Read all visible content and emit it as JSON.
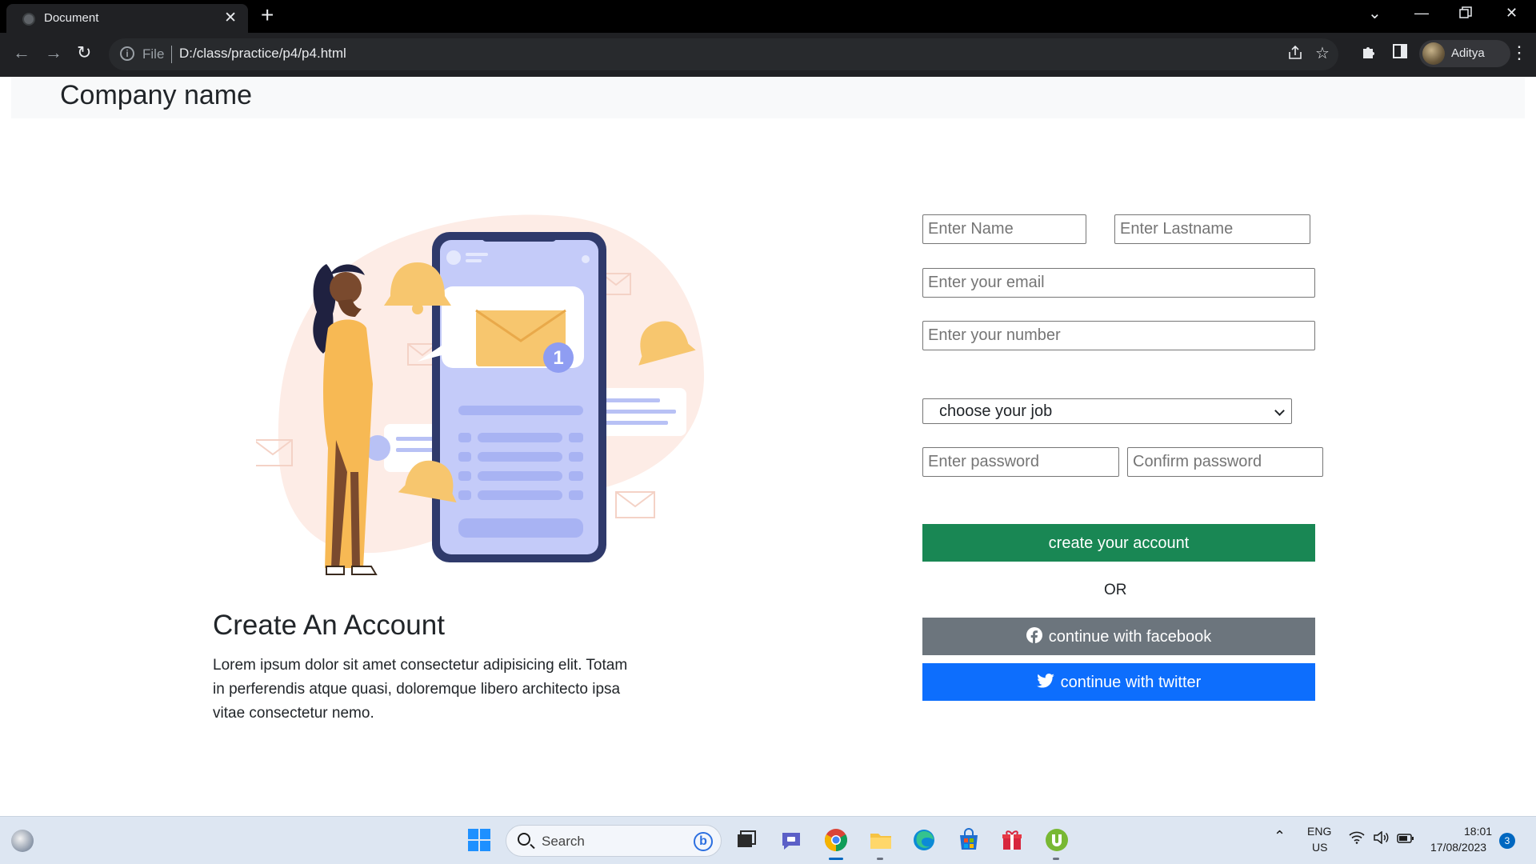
{
  "browser": {
    "tab_title": "Document",
    "tab_close": "✕",
    "new_tab": "+",
    "url_scheme": "File",
    "url": "D:/class/practice/p4/p4.html",
    "profile_name": "Aditya"
  },
  "navbar": {
    "brand": "Company name"
  },
  "hero": {
    "title": "Create An Account",
    "text": "Lorem ipsum dolor sit amet consectetur adipisicing elit. Totam in perferendis atque quasi, doloremque libero architecto ipsa vitae consectetur nemo.",
    "illustration_badge": "1"
  },
  "form": {
    "first_name_placeholder": "Enter Name",
    "last_name_placeholder": "Enter Lastname",
    "email_placeholder": "Enter your email",
    "number_placeholder": "Enter your number",
    "job_select_value": "choose your job",
    "password_placeholder": "Enter password",
    "confirm_password_placeholder": "Confirm password",
    "create_button": "create your account",
    "or_text": "OR",
    "facebook_button": "continue with facebook",
    "twitter_button": "continue with twitter"
  },
  "colors": {
    "create_button": "#198754",
    "facebook_button": "#6c757d",
    "twitter_button": "#0d6efd",
    "navbar_bg": "#f8f9fa"
  },
  "taskbar": {
    "search_label": "Search",
    "language": "ENG",
    "region": "US",
    "time": "18:01",
    "date": "17/08/2023",
    "notification_count": "3",
    "icons": [
      "weather-icon",
      "windows-start-icon",
      "search-icon",
      "bing-icon",
      "task-view-icon",
      "teams-chat-icon",
      "chrome-icon",
      "file-explorer-icon",
      "edge-icon",
      "microsoft-store-icon",
      "gift-app-icon",
      "utorrent-icon",
      "chevron-up-icon",
      "wifi-icon",
      "volume-icon",
      "battery-icon"
    ]
  }
}
